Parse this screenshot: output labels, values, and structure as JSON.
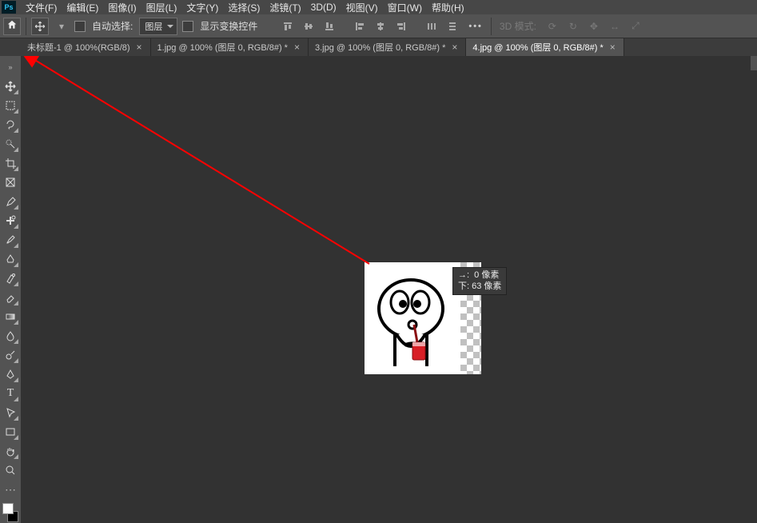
{
  "menubar": [
    {
      "label": "文件(F)"
    },
    {
      "label": "编辑(E)"
    },
    {
      "label": "图像(I)"
    },
    {
      "label": "图层(L)"
    },
    {
      "label": "文字(Y)"
    },
    {
      "label": "选择(S)"
    },
    {
      "label": "滤镜(T)"
    },
    {
      "label": "3D(D)"
    },
    {
      "label": "视图(V)"
    },
    {
      "label": "窗口(W)"
    },
    {
      "label": "帮助(H)"
    }
  ],
  "options": {
    "auto_select_label": "自动选择:",
    "auto_select_value": "图层",
    "show_transform_label": "显示变换控件",
    "three_d_label": "3D 模式:"
  },
  "tabs": [
    {
      "label": "未标题-1 @ 100%(RGB/8)",
      "active": false
    },
    {
      "label": "1.jpg @ 100% (图层 0, RGB/8#) *",
      "active": false
    },
    {
      "label": "3.jpg @ 100% (图层 0, RGB/8#) *",
      "active": false
    },
    {
      "label": "4.jpg @ 100% (图层 0, RGB/8#) *",
      "active": true
    }
  ],
  "drag_info": {
    "line1": "→:  0 像素",
    "line2": "下: 63 像素"
  },
  "tools": [
    "move",
    "marquee",
    "lasso",
    "quick-select",
    "crop",
    "frame",
    "eyedropper",
    "spot-heal",
    "brush",
    "clone",
    "history-brush",
    "eraser",
    "gradient",
    "blur",
    "dodge",
    "pen",
    "type",
    "path-select",
    "rectangle",
    "hand",
    "zoom",
    "edit-toolbar"
  ]
}
